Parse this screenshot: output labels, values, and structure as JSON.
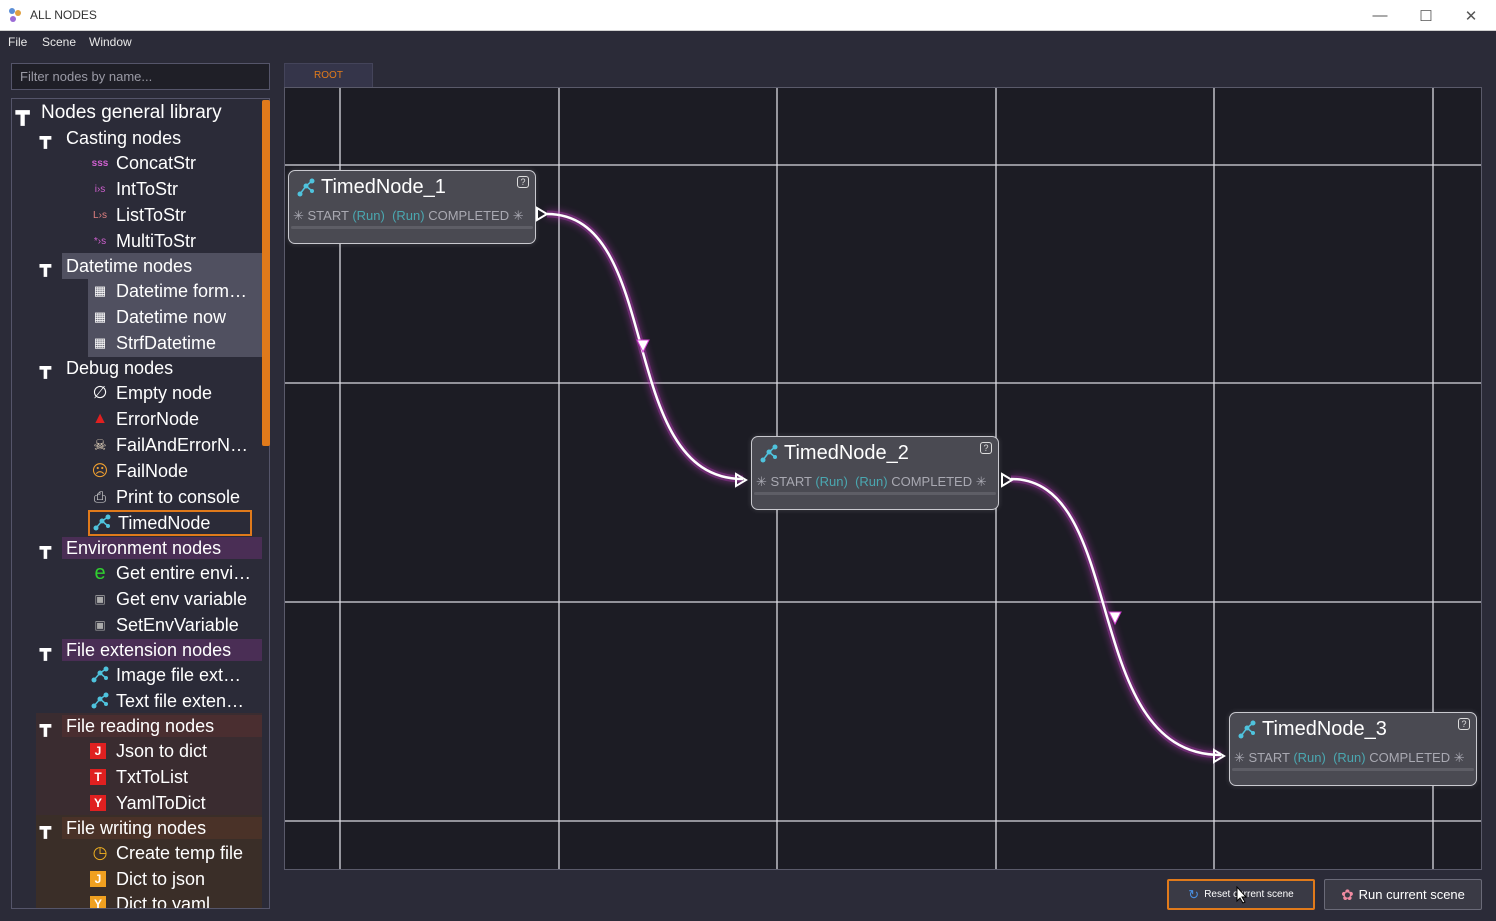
{
  "window": {
    "title": "ALL NODES",
    "minimize": "—",
    "maximize": "☐",
    "close": "✕"
  },
  "menu": {
    "file": "File",
    "scene": "Scene",
    "window": "Window"
  },
  "filter": {
    "placeholder": "Filter nodes by name..."
  },
  "library": {
    "root": "Nodes general library",
    "categories": [
      {
        "label": "Casting nodes",
        "items": [
          {
            "label": "ConcatStr",
            "icon": "sss-icon"
          },
          {
            "label": "IntToStr",
            "icon": "int-to-str-icon"
          },
          {
            "label": "ListToStr",
            "icon": "list-to-str-icon"
          },
          {
            "label": "MultiToStr",
            "icon": "multi-to-str-icon"
          }
        ]
      },
      {
        "label": "Datetime nodes",
        "items": [
          {
            "label": "Datetime form…",
            "icon": "calendar-icon"
          },
          {
            "label": "Datetime now",
            "icon": "calendar-icon"
          },
          {
            "label": "StrfDatetime",
            "icon": "calendar-icon"
          }
        ]
      },
      {
        "label": "Debug nodes",
        "items": [
          {
            "label": "Empty node",
            "icon": "empty-set-icon"
          },
          {
            "label": "ErrorNode",
            "icon": "warning-icon"
          },
          {
            "label": "FailAndErrorN…",
            "icon": "skull-icon"
          },
          {
            "label": "FailNode",
            "icon": "sad-face-icon"
          },
          {
            "label": "Print to console",
            "icon": "printer-icon"
          },
          {
            "label": "TimedNode",
            "icon": "node-graph-icon"
          }
        ]
      },
      {
        "label": "Environment nodes",
        "items": [
          {
            "label": "Get entire envi…",
            "icon": "e-icon"
          },
          {
            "label": "Get env variable",
            "icon": "env-var-icon"
          },
          {
            "label": "SetEnvVariable",
            "icon": "env-var-icon"
          }
        ]
      },
      {
        "label": "File extension nodes",
        "items": [
          {
            "label": "Image file ext…",
            "icon": "node-graph-icon"
          },
          {
            "label": "Text file exten…",
            "icon": "node-graph-icon"
          }
        ]
      },
      {
        "label": "File reading nodes",
        "items": [
          {
            "label": "Json to dict",
            "icon": "j-icon"
          },
          {
            "label": "TxtToList",
            "icon": "t-icon"
          },
          {
            "label": "YamlToDict",
            "icon": "y-icon"
          }
        ]
      },
      {
        "label": "File writing nodes",
        "items": [
          {
            "label": "Create temp file",
            "icon": "clock-icon"
          },
          {
            "label": "Dict to json",
            "icon": "j-icon"
          },
          {
            "label": "Dict to yaml",
            "icon": "y-icon"
          }
        ]
      }
    ]
  },
  "scene_tab": {
    "label": "ROOT"
  },
  "nodes": [
    {
      "title": "TimedNode_1",
      "start": "START",
      "run1": "(Run)",
      "run2": "(Run)",
      "completed": "COMPLETED",
      "help": "?"
    },
    {
      "title": "TimedNode_2",
      "start": "START",
      "run1": "(Run)",
      "run2": "(Run)",
      "completed": "COMPLETED",
      "help": "?"
    },
    {
      "title": "TimedNode_3",
      "start": "START",
      "run1": "(Run)",
      "run2": "(Run)",
      "completed": "COMPLETED",
      "help": "?"
    }
  ],
  "buttons": {
    "reset": "Reset current scene",
    "run": "Run current scene"
  },
  "colors": {
    "accent": "#e07a1b",
    "connection": "#ff66ff",
    "port_text": "#4aa7b0"
  }
}
